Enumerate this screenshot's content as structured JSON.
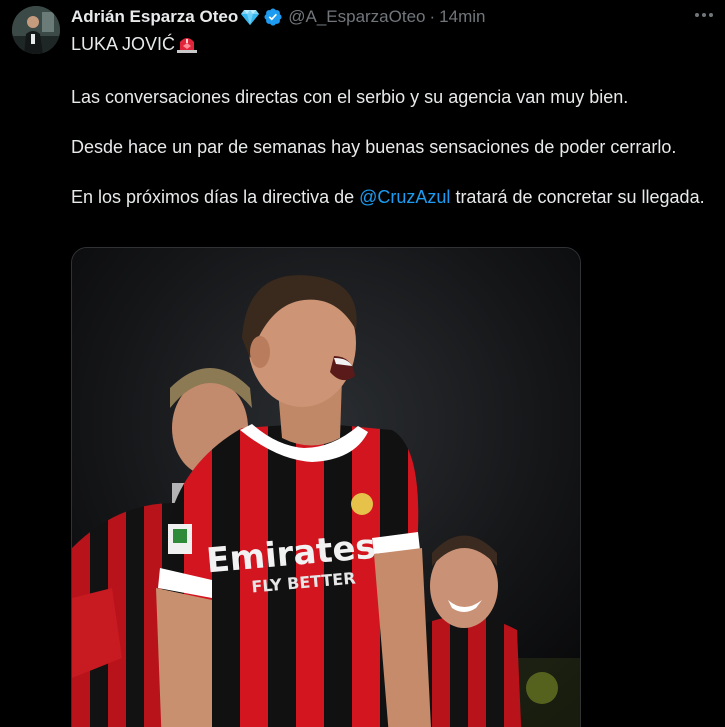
{
  "author": {
    "name": "Adrián Esparza Oteo",
    "handle": "@A_EsparzaOteo",
    "separator": "·",
    "time": "14min"
  },
  "icons": {
    "gem": "gem-icon",
    "verified": "verified-badge-icon",
    "more": "more-options-icon",
    "siren": "rotating-light-icon"
  },
  "tweet": {
    "line1": "LUKA JOVIĆ",
    "para1": "Las conversaciones directas con el serbio y su agencia van muy bien.",
    "para2": "Desde hace un par de semanas hay buenas sensaciones de poder cerrarlo.",
    "para3_before": "En los próximos días la directiva de ",
    "mention": "@CruzAzul",
    "para3_after": " tratará de concretar su llegada."
  },
  "media": {
    "jersey_sponsor": "Emirates",
    "jersey_sponsor_sub": "FLY BETTER"
  },
  "colors": {
    "background": "#000000",
    "text": "#e7e9ea",
    "muted": "#71767b",
    "link": "#1d9bf0",
    "verified": "#1d9bf0",
    "jersey_red": "#d3151f",
    "jersey_black": "#111111"
  }
}
